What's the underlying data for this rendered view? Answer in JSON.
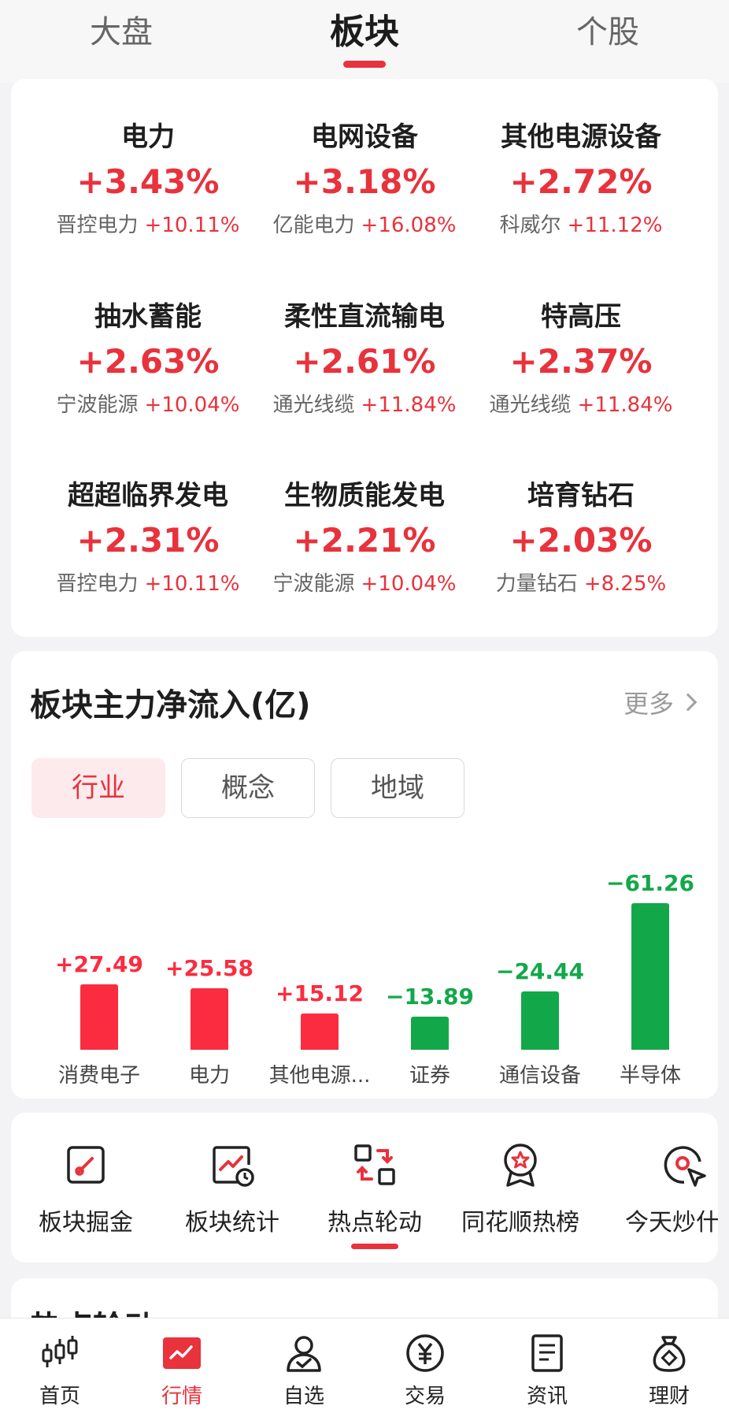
{
  "top_tabs": {
    "market": "大盘",
    "sector": "板块",
    "stock": "个股"
  },
  "sectors": [
    {
      "name": "电力",
      "pct": "+3.43%",
      "leader": "晋控电力",
      "leader_pct": "+10.11%"
    },
    {
      "name": "电网设备",
      "pct": "+3.18%",
      "leader": "亿能电力",
      "leader_pct": "+16.08%"
    },
    {
      "name": "其他电源设备",
      "pct": "+2.72%",
      "leader": "科威尔",
      "leader_pct": "+11.12%"
    },
    {
      "name": "抽水蓄能",
      "pct": "+2.63%",
      "leader": "宁波能源",
      "leader_pct": "+10.04%"
    },
    {
      "name": "柔性直流输电",
      "pct": "+2.61%",
      "leader": "通光线缆",
      "leader_pct": "+11.84%"
    },
    {
      "name": "特高压",
      "pct": "+2.37%",
      "leader": "通光线缆",
      "leader_pct": "+11.84%"
    },
    {
      "name": "超超临界发电",
      "pct": "+2.31%",
      "leader": "晋控电力",
      "leader_pct": "+10.11%"
    },
    {
      "name": "生物质能发电",
      "pct": "+2.21%",
      "leader": "宁波能源",
      "leader_pct": "+10.04%"
    },
    {
      "name": "培育钻石",
      "pct": "+2.03%",
      "leader": "力量钻石",
      "leader_pct": "+8.25%"
    }
  ],
  "flow": {
    "title": "板块主力净流入(亿)",
    "more": "更多",
    "segments": [
      "行业",
      "概念",
      "地域"
    ],
    "selected_segment": "行业"
  },
  "chart_data": {
    "type": "bar",
    "categories": [
      "消费电子",
      "电力",
      "其他电源...",
      "证券",
      "通信设备",
      "半导体"
    ],
    "labels": [
      "+27.49",
      "+25.58",
      "+15.12",
      "−13.89",
      "−24.44",
      "−61.26"
    ],
    "values": [
      27.49,
      25.58,
      15.12,
      -13.89,
      -24.44,
      -61.26
    ],
    "positive_color": "#fb2c3f",
    "negative_color": "#12a84a"
  },
  "tools": [
    {
      "label": "板块掘金",
      "icon": "gold-dig-icon"
    },
    {
      "label": "板块统计",
      "icon": "chart-clock-icon"
    },
    {
      "label": "热点轮动",
      "icon": "rotation-icon"
    },
    {
      "label": "同花顺热榜",
      "icon": "star-badge-icon"
    },
    {
      "label": "今天炒什么",
      "icon": "target-cursor-icon"
    }
  ],
  "next_section": {
    "title": "热点轮动"
  },
  "bottom_nav": [
    {
      "label": "首页",
      "icon": "candlestick-icon"
    },
    {
      "label": "行情",
      "icon": "market-chart-icon"
    },
    {
      "label": "自选",
      "icon": "user-check-icon"
    },
    {
      "label": "交易",
      "icon": "yuan-icon"
    },
    {
      "label": "资讯",
      "icon": "document-icon"
    },
    {
      "label": "理财",
      "icon": "money-bag-icon"
    }
  ],
  "colors": {
    "accent": "#e8323c",
    "up": "#e8323c",
    "down": "#12a84a"
  }
}
